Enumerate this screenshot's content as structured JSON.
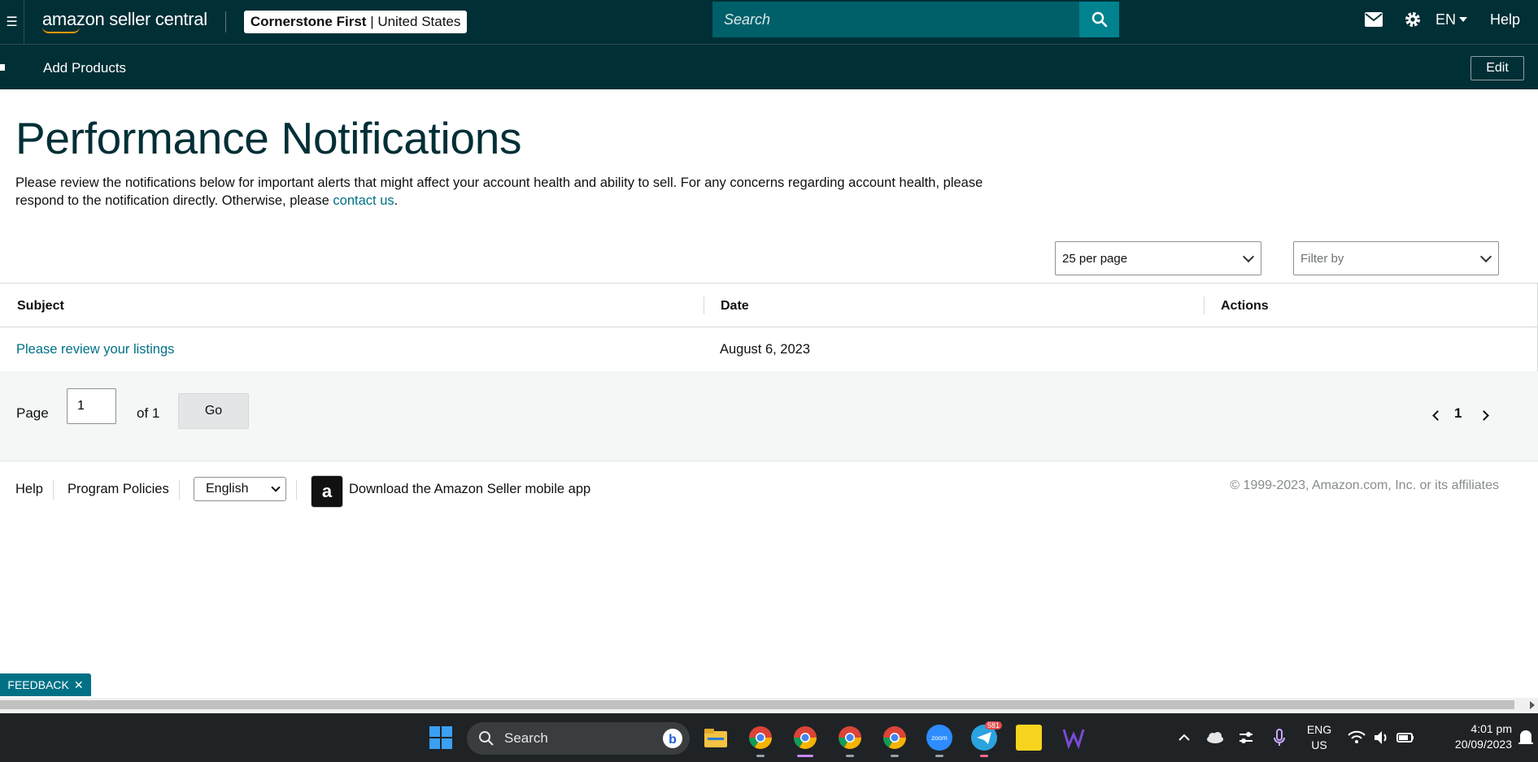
{
  "header": {
    "logo_text": "amazon seller central",
    "store_name": "Cornerstone First",
    "store_region": "United States",
    "search_placeholder": "Search",
    "language": "EN",
    "help": "Help"
  },
  "subnav": {
    "add_products": "Add Products",
    "edit": "Edit"
  },
  "page": {
    "title": "Performance Notifications",
    "intro_text": "Please review the notifications below for important alerts that might affect your account health and ability to sell. For any concerns regarding account health, please respond to the notification directly. Otherwise, please ",
    "contact_link": "contact us",
    "intro_end": "."
  },
  "controls": {
    "per_page": "25 per page",
    "filter_by": "Filter by"
  },
  "table": {
    "headers": [
      "Subject",
      "Date",
      "Actions"
    ],
    "rows": [
      {
        "subject": "Please review your listings",
        "date": "August 6, 2023",
        "actions": ""
      }
    ]
  },
  "pagination": {
    "page_label": "Page",
    "page_value": "1",
    "of_label": "of 1",
    "go": "Go",
    "current": "1"
  },
  "footer": {
    "help": "Help",
    "program_policies": "Program Policies",
    "language": "English",
    "app_icon_letter": "a",
    "download_app": "Download the Amazon Seller mobile app",
    "copyright": "© 1999-2023, Amazon.com, Inc. or its affiliates"
  },
  "feedback": {
    "label": "FEEDBACK",
    "close": "✕"
  },
  "taskbar": {
    "search": "Search",
    "lang_top": "ENG",
    "lang_bottom": "US",
    "time": "4:01 pm",
    "date": "20/09/2023",
    "badge_telegram": "581",
    "icons": [
      "start-icon",
      "search-icon",
      "bing-icon",
      "file-explorer-icon",
      "chrome-icon",
      "chrome-icon",
      "chrome-icon",
      "chrome-icon",
      "zoom-icon",
      "telegram-icon",
      "sticky-notes-icon",
      "w-app-icon",
      "chevron-up-icon",
      "cloud-icon",
      "settings-icon",
      "microphone-icon",
      "wifi-icon",
      "speaker-icon",
      "battery-icon",
      "notification-icon"
    ],
    "zoom_label": "zoom"
  },
  "colors": {
    "header_bg": "#002f36",
    "search_bg": "#006069",
    "search_btn": "#00838f",
    "link": "#007185",
    "taskbar_bg": "#1f2326"
  }
}
